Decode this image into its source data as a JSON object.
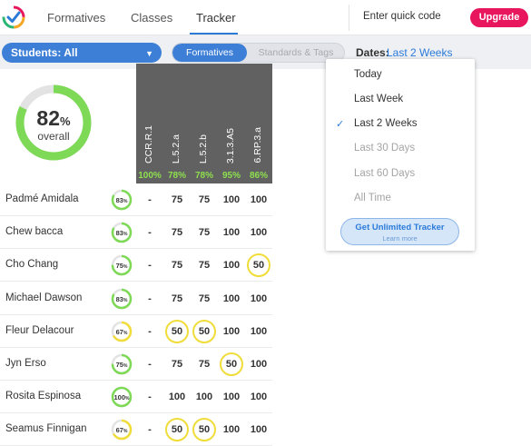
{
  "nav": {
    "tabs": [
      "Formatives",
      "Classes",
      "Tracker"
    ],
    "active_tab": "Tracker",
    "quick_code_placeholder": "Enter quick code",
    "upgrade_label": "Upgrade"
  },
  "filters": {
    "students_label": "Students: All",
    "segment_active": "Formatives",
    "segment_inactive": "Standards & Tags",
    "dates_label": "Dates:",
    "dates_value": "Last 2 Weeks"
  },
  "overall": {
    "value": "82",
    "unit": "%",
    "label": "overall",
    "fraction": 0.82
  },
  "columns": [
    {
      "label": "CCR.R.1",
      "pct": "100%"
    },
    {
      "label": "L.5.2.a",
      "pct": "78%"
    },
    {
      "label": "L.5.2.b",
      "pct": "78%"
    },
    {
      "label": "3.1.3.A5",
      "pct": "95%"
    },
    {
      "label": "6.RP.3.a",
      "pct": "86%"
    }
  ],
  "students": [
    {
      "name": "Padmé Amidala",
      "score": "83",
      "fraction": 0.83,
      "scores": [
        "-",
        "75",
        "75",
        "100",
        "100"
      ],
      "flagged": [
        false,
        false,
        false,
        false,
        false
      ]
    },
    {
      "name": "Chew bacca",
      "score": "83",
      "fraction": 0.83,
      "scores": [
        "-",
        "75",
        "75",
        "100",
        "100"
      ],
      "flagged": [
        false,
        false,
        false,
        false,
        false
      ]
    },
    {
      "name": "Cho Chang",
      "score": "75",
      "fraction": 0.75,
      "scores": [
        "-",
        "75",
        "75",
        "100",
        "50"
      ],
      "flagged": [
        false,
        false,
        false,
        false,
        true
      ]
    },
    {
      "name": "Michael Dawson",
      "score": "83",
      "fraction": 0.83,
      "scores": [
        "-",
        "75",
        "75",
        "100",
        "100"
      ],
      "flagged": [
        false,
        false,
        false,
        false,
        false
      ]
    },
    {
      "name": "Fleur Delacour",
      "score": "67",
      "fraction": 0.67,
      "scores": [
        "-",
        "50",
        "50",
        "100",
        "100"
      ],
      "flagged": [
        false,
        true,
        true,
        false,
        false
      ]
    },
    {
      "name": "Jyn Erso",
      "score": "75",
      "fraction": 0.75,
      "scores": [
        "-",
        "75",
        "75",
        "50",
        "100"
      ],
      "flagged": [
        false,
        false,
        false,
        true,
        false
      ]
    },
    {
      "name": "Rosita Espinosa",
      "score": "100",
      "fraction": 1.0,
      "scores": [
        "-",
        "100",
        "100",
        "100",
        "100"
      ],
      "flagged": [
        false,
        false,
        false,
        false,
        false
      ]
    },
    {
      "name": "Seamus Finnigan",
      "score": "67",
      "fraction": 0.67,
      "scores": [
        "-",
        "50",
        "50",
        "100",
        "100"
      ],
      "flagged": [
        false,
        true,
        true,
        false,
        false
      ]
    }
  ],
  "score_unit": "%",
  "dropdown": {
    "items": [
      {
        "label": "Today",
        "selected": false,
        "disabled": false
      },
      {
        "label": "Last Week",
        "selected": false,
        "disabled": false
      },
      {
        "label": "Last 2 Weeks",
        "selected": true,
        "disabled": false
      },
      {
        "label": "Last 30 Days",
        "selected": false,
        "disabled": true
      },
      {
        "label": "Last 60 Days",
        "selected": false,
        "disabled": true
      },
      {
        "label": "All Time",
        "selected": false,
        "disabled": true
      }
    ],
    "check_glyph": "✓",
    "unlimited_title": "Get Unlimited Tracker",
    "unlimited_sub": "Learn more"
  },
  "colors": {
    "accent": "#2a7ad8",
    "upgrade": "#e8175d",
    "good": "#7ed957",
    "warn": "#f0dd3a",
    "header_bg": "#616161"
  }
}
